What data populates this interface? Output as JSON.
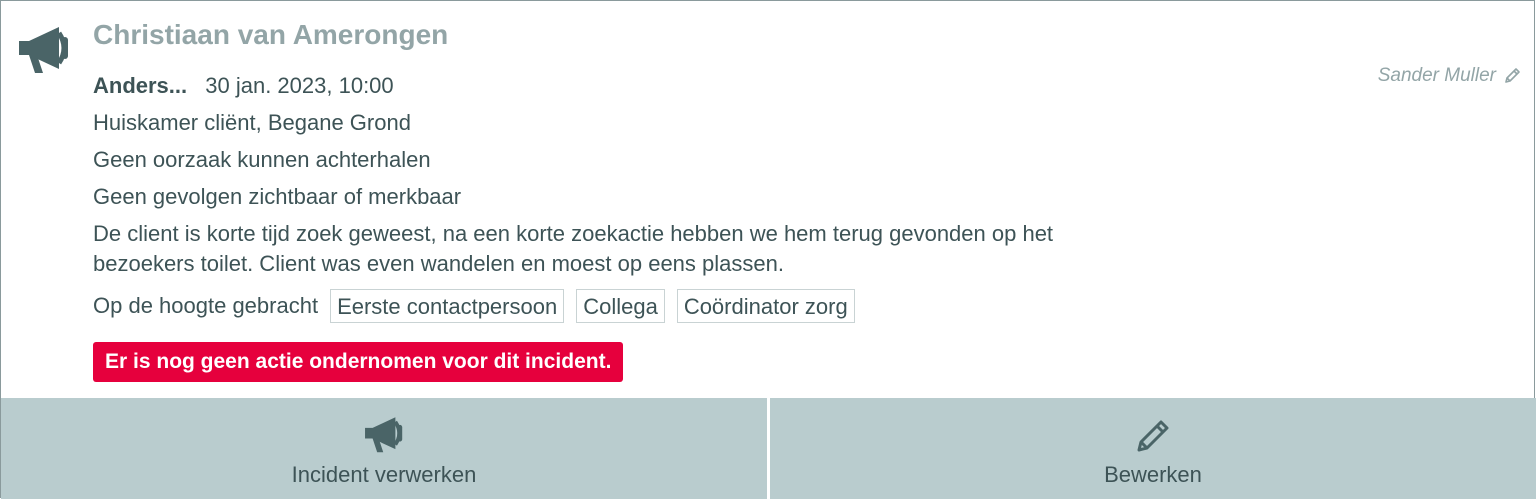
{
  "incident": {
    "client_name": "Christiaan van Amerongen",
    "type": "Anders...",
    "datetime": "30 jan. 2023, 10:00",
    "author": "Sander Muller",
    "location": "Huiskamer cliënt, Begane Grond",
    "cause": "Geen oorzaak kunnen achterhalen",
    "consequences": "Geen gevolgen zichtbaar of merkbaar",
    "description": "De client is korte tijd zoek geweest, na een korte zoekactie hebben we hem terug gevonden op het bezoekers toilet. Client was even wandelen en moest op eens plassen.",
    "informed_label": "Op de hoogte gebracht",
    "informed": [
      "Eerste contactpersoon",
      "Collega",
      "Coördinator zorg"
    ],
    "alert": "Er is nog geen actie ondernomen voor dit incident."
  },
  "actions": {
    "process_label": "Incident verwerken",
    "edit_label": "Bewerken"
  },
  "icons": {
    "main": "megaphone-icon",
    "author_edit": "pencil-icon",
    "process": "megaphone-icon",
    "edit": "pencil-icon"
  },
  "colors": {
    "primary_text": "#3d5356",
    "muted_text": "#93a5a7",
    "alert_bg": "#e6003d",
    "action_bg": "#b9ccce",
    "icon": "#4a6467"
  }
}
